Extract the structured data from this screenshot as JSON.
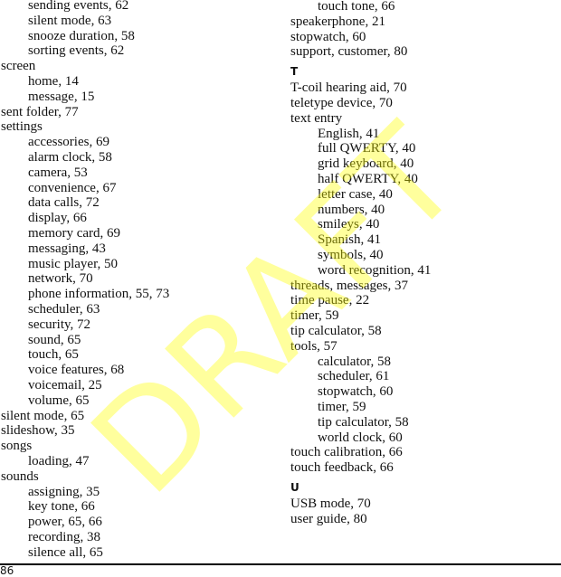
{
  "page_number": "86",
  "watermark": "DRAFT",
  "left_column": [
    {
      "text": "sending events, 62",
      "level": 1
    },
    {
      "text": "silent mode, 63",
      "level": 1
    },
    {
      "text": "snooze duration, 58",
      "level": 1
    },
    {
      "text": "sorting events, 62",
      "level": 1
    },
    {
      "text": "screen",
      "level": 0
    },
    {
      "text": "home, 14",
      "level": 1
    },
    {
      "text": "message, 15",
      "level": 1
    },
    {
      "text": "sent folder, 77",
      "level": 0
    },
    {
      "text": "settings",
      "level": 0
    },
    {
      "text": "accessories, 69",
      "level": 1
    },
    {
      "text": "alarm clock, 58",
      "level": 1
    },
    {
      "text": "camera, 53",
      "level": 1
    },
    {
      "text": "convenience, 67",
      "level": 1
    },
    {
      "text": "data calls, 72",
      "level": 1
    },
    {
      "text": "display, 66",
      "level": 1
    },
    {
      "text": "memory card, 69",
      "level": 1
    },
    {
      "text": "messaging, 43",
      "level": 1
    },
    {
      "text": "music player, 50",
      "level": 1
    },
    {
      "text": "network, 70",
      "level": 1
    },
    {
      "text": "phone information, 55, 73",
      "level": 1
    },
    {
      "text": "scheduler, 63",
      "level": 1
    },
    {
      "text": "security, 72",
      "level": 1
    },
    {
      "text": "sound, 65",
      "level": 1
    },
    {
      "text": "touch, 65",
      "level": 1
    },
    {
      "text": "voice features, 68",
      "level": 1
    },
    {
      "text": "voicemail, 25",
      "level": 1
    },
    {
      "text": "volume, 65",
      "level": 1
    },
    {
      "text": "silent mode, 65",
      "level": 0
    },
    {
      "text": "slideshow, 35",
      "level": 0
    },
    {
      "text": "songs",
      "level": 0
    },
    {
      "text": "loading, 47",
      "level": 1
    },
    {
      "text": "sounds",
      "level": 0
    },
    {
      "text": "assigning, 35",
      "level": 1
    },
    {
      "text": "key tone, 66",
      "level": 1
    },
    {
      "text": "power, 65, 66",
      "level": 1
    },
    {
      "text": "recording, 38",
      "level": 1
    },
    {
      "text": "silence all, 65",
      "level": 1
    }
  ],
  "right_column": [
    {
      "text": "touch tone, 66",
      "level": 1
    },
    {
      "text": "speakerphone, 21",
      "level": 0
    },
    {
      "text": "stopwatch, 60",
      "level": 0
    },
    {
      "text": "support, customer, 80",
      "level": 0
    },
    {
      "text": "T",
      "level": "letter"
    },
    {
      "text": "T-coil hearing aid, 70",
      "level": 0
    },
    {
      "text": "teletype device, 70",
      "level": 0
    },
    {
      "text": "text entry",
      "level": 0
    },
    {
      "text": "English, 41",
      "level": 1
    },
    {
      "text": "full QWERTY, 40",
      "level": 1
    },
    {
      "text": "grid keyboard, 40",
      "level": 1
    },
    {
      "text": "half QWERTY, 40",
      "level": 1
    },
    {
      "text": "letter case, 40",
      "level": 1
    },
    {
      "text": "numbers, 40",
      "level": 1
    },
    {
      "text": "smileys, 40",
      "level": 1
    },
    {
      "text": "Spanish, 41",
      "level": 1
    },
    {
      "text": "symbols, 40",
      "level": 1
    },
    {
      "text": "word recognition, 41",
      "level": 1
    },
    {
      "text": "threads, messages, 37",
      "level": 0
    },
    {
      "text": "time pause, 22",
      "level": 0
    },
    {
      "text": "timer, 59",
      "level": 0
    },
    {
      "text": "tip calculator, 58",
      "level": 0
    },
    {
      "text": "tools, 57",
      "level": 0
    },
    {
      "text": "calculator, 58",
      "level": 1
    },
    {
      "text": "scheduler, 61",
      "level": 1
    },
    {
      "text": "stopwatch, 60",
      "level": 1
    },
    {
      "text": "timer, 59",
      "level": 1
    },
    {
      "text": "tip calculator, 58",
      "level": 1
    },
    {
      "text": "world clock, 60",
      "level": 1
    },
    {
      "text": "touch calibration, 66",
      "level": 0
    },
    {
      "text": "touch feedback, 66",
      "level": 0
    },
    {
      "text": "U",
      "level": "letter"
    },
    {
      "text": "USB mode, 70",
      "level": 0
    },
    {
      "text": "user guide, 80",
      "level": 0
    }
  ]
}
